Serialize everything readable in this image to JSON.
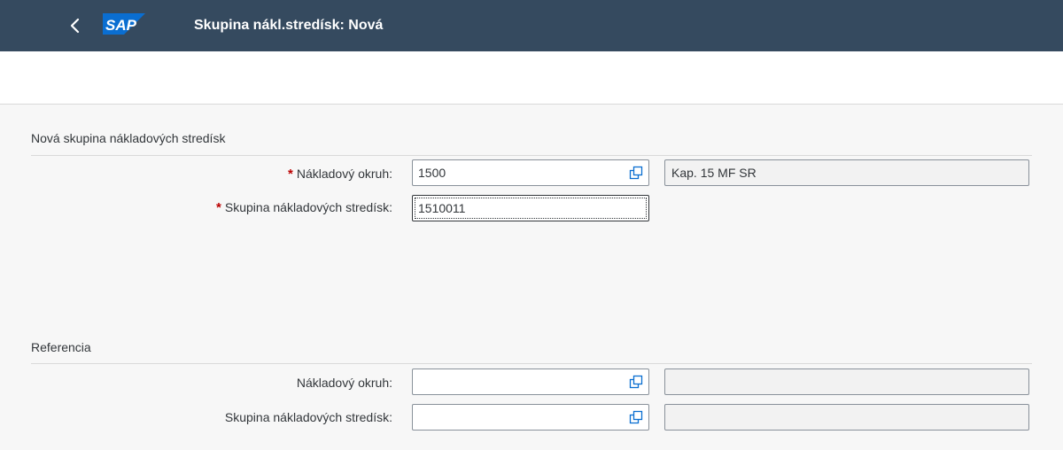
{
  "header": {
    "title": "Skupina nákl.stredísk: Nová",
    "logo_text": "SAP",
    "back_icon": "chevron-left-icon"
  },
  "colors": {
    "shell": "#354a5f",
    "required": "#bb0000",
    "brand_blue": "#0a6ed1"
  },
  "section_new": {
    "title": "Nová skupina nákladových stredísk",
    "controlling_area": {
      "label": "Nákladový okruh:",
      "required_mark": "*",
      "value": "1500",
      "description": "Kap. 15 MF SR"
    },
    "group": {
      "label": "Skupina nákladových stredísk:",
      "required_mark": "*",
      "value": "1510011"
    }
  },
  "section_ref": {
    "title": "Referencia",
    "controlling_area": {
      "label": "Nákladový okruh:",
      "value": "",
      "description": ""
    },
    "group": {
      "label": "Skupina nákladových stredísk:",
      "value": "",
      "description": ""
    }
  }
}
